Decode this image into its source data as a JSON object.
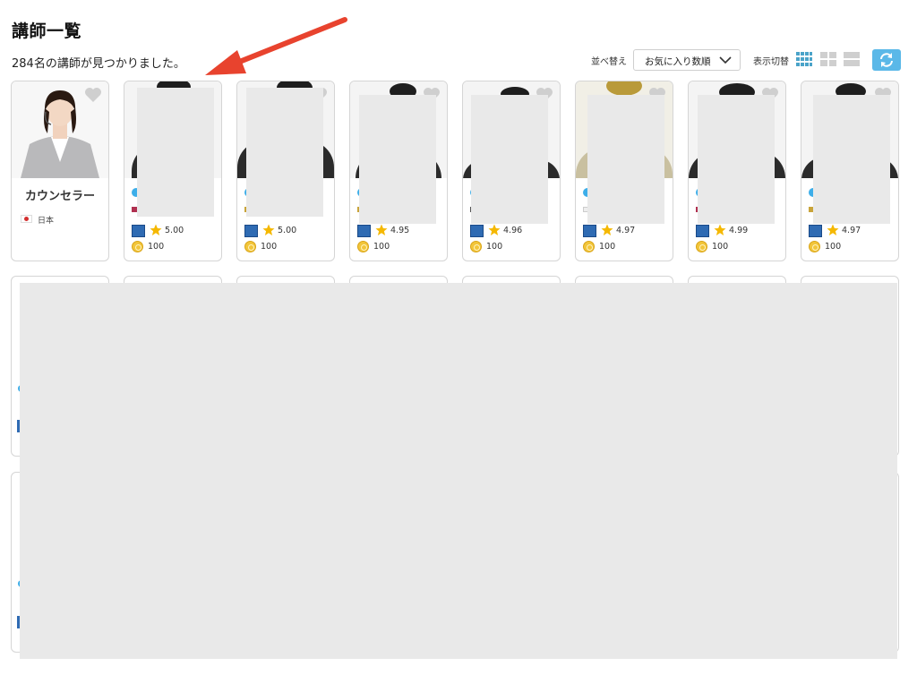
{
  "page": {
    "title": "講師一覧",
    "result_count": "284名の講師が見つかりました。"
  },
  "controls": {
    "sort_label": "並べ替え",
    "sort_value": "お気に入り数順",
    "view_label": "表示切替",
    "view_modes": [
      "grid-4-icon",
      "grid-2-icon",
      "list-icon"
    ],
    "refresh_icon": "refresh-icon"
  },
  "colors": {
    "accent_blue": "#5ab8e8",
    "annotation_arrow": "#e8432e",
    "star": "#f5b800",
    "coin": "#f2c53a"
  },
  "counselor_card": {
    "name": "カウンセラー",
    "country": "日本"
  },
  "tutors": [
    {
      "rating": "5.00",
      "points": "100"
    },
    {
      "rating": "5.00",
      "points": "100"
    },
    {
      "rating": "4.95",
      "points": "100"
    },
    {
      "rating": "4.96",
      "points": "100"
    },
    {
      "rating": "4.97",
      "points": "100"
    },
    {
      "rating": "4.99",
      "points": "100"
    },
    {
      "rating": "4.97",
      "points": "100"
    }
  ]
}
